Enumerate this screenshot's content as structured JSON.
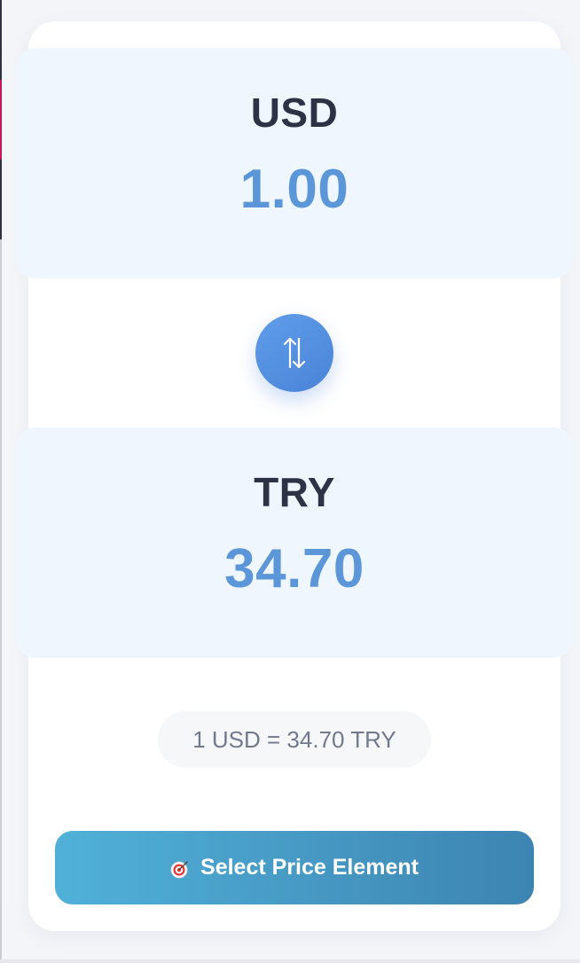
{
  "converter": {
    "from": {
      "code": "USD",
      "amount": "1.00"
    },
    "to": {
      "code": "TRY",
      "amount": "34.70"
    },
    "swap_icon": "swap-vertical-arrows-icon",
    "rate_text": "1 USD = 34.70 TRY"
  },
  "actions": {
    "select_price_label": "Select Price Element",
    "select_price_icon": "target-icon"
  },
  "colors": {
    "amount": "#5b96d8",
    "code": "#2c3344",
    "panel_bg": "#eff6fe",
    "swap_button": "#4a83d8",
    "select_button_start": "#50b1d8",
    "select_button_end": "#3d84b2"
  }
}
